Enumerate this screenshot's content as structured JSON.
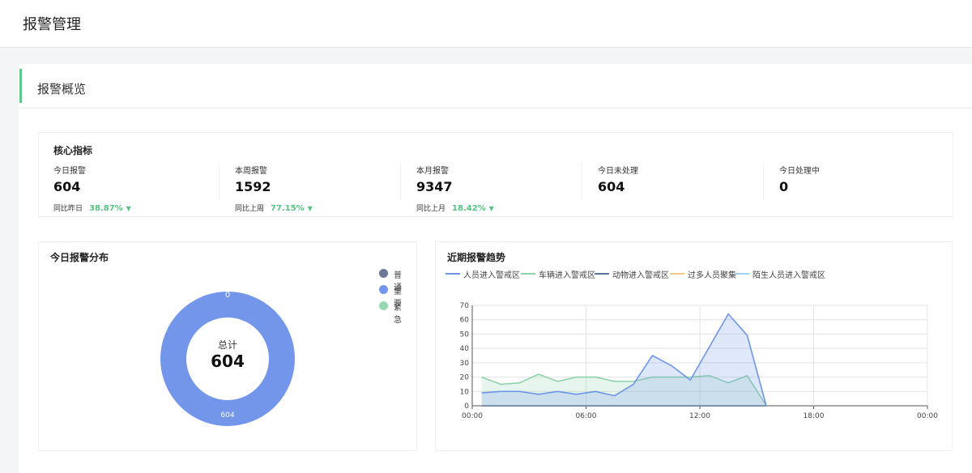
{
  "header": {
    "title": "报警管理"
  },
  "overview": {
    "title": "报警概览"
  },
  "core": {
    "title": "核心指标",
    "metrics": [
      {
        "label": "今日报警",
        "value": "604",
        "compare_label": "同比昨日",
        "percent": "38.87%",
        "trend": "down"
      },
      {
        "label": "本周报警",
        "value": "1592",
        "compare_label": "同比上周",
        "percent": "77.15%",
        "trend": "down"
      },
      {
        "label": "本月报警",
        "value": "9347",
        "compare_label": "同比上月",
        "percent": "18.42%",
        "trend": "down"
      },
      {
        "label": "今日未处理",
        "value": "604"
      },
      {
        "label": "今日处理中",
        "value": "0"
      }
    ]
  },
  "distribution": {
    "title": "今日报警分布",
    "total_label": "总计",
    "total_value": "604",
    "legend": [
      {
        "name": "普通",
        "color": "#6e7896"
      },
      {
        "name": "重要",
        "color": "#7396ea"
      },
      {
        "name": "紧急",
        "color": "#96d7b1"
      }
    ]
  },
  "chart_data": [
    {
      "type": "pie",
      "title": "今日报警分布",
      "labels": [
        "普通",
        "重要",
        "紧急"
      ],
      "values": [
        0,
        604,
        0
      ],
      "colors": [
        "#6e7896",
        "#7396ea",
        "#96d7b1"
      ],
      "visible_value_labels": [
        "0",
        "604"
      ]
    },
    {
      "type": "area",
      "title": "近期报警趋势",
      "x": [
        "00:00",
        "01:00",
        "02:00",
        "03:00",
        "04:00",
        "05:00",
        "06:00",
        "07:00",
        "08:00",
        "09:00",
        "10:00",
        "11:00",
        "12:00",
        "13:00",
        "14:00",
        "15:00"
      ],
      "x_ticks": [
        "00:00",
        "06:00",
        "12:00",
        "18:00",
        "00:00"
      ],
      "x_tick_positions": [
        0,
        6,
        12,
        18,
        24
      ],
      "xlim": [
        0,
        24
      ],
      "ylim": [
        0,
        70
      ],
      "y_ticks": [
        0,
        10,
        20,
        30,
        40,
        50,
        60,
        70
      ],
      "grid": true,
      "legend_position": "top-left",
      "series": [
        {
          "name": "人员进入警戒区",
          "color": "#6f96e6",
          "values": [
            9,
            10,
            10,
            8,
            10,
            8,
            10,
            7,
            15,
            35,
            28,
            18,
            41,
            64,
            49,
            0
          ]
        },
        {
          "name": "车辆进入警戒区",
          "color": "#8fd3ab",
          "values": [
            20,
            15,
            16,
            22,
            17,
            20,
            20,
            17,
            17,
            20,
            20,
            20,
            21,
            16,
            21,
            0
          ]
        },
        {
          "name": "动物进入警戒区",
          "color": "#5b6f9c",
          "values": [
            0,
            0,
            0,
            0,
            0,
            0,
            0,
            0,
            0,
            0,
            0,
            0,
            0,
            0,
            0,
            0
          ]
        },
        {
          "name": "过多人员聚集",
          "color": "#f3c889",
          "values": [
            0,
            0,
            0,
            0,
            0,
            0,
            0,
            0,
            0,
            0,
            0,
            0,
            0,
            0,
            0,
            0
          ]
        },
        {
          "name": "陌生人员进入警戒区",
          "color": "#9ed3ef",
          "values": [
            0,
            0,
            0,
            0,
            0,
            0,
            0,
            0,
            0,
            0,
            0,
            0,
            0,
            0,
            0,
            0
          ]
        }
      ]
    }
  ]
}
